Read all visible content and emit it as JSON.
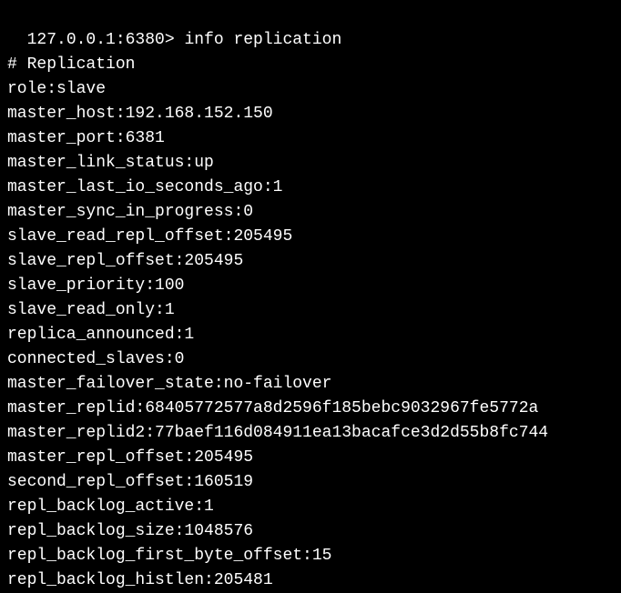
{
  "terminal": {
    "prompt": "127.0.0.1:6380> ",
    "command": "info replication",
    "output": {
      "header": "# Replication",
      "lines": [
        "role:slave",
        "master_host:192.168.152.150",
        "master_port:6381",
        "master_link_status:up",
        "master_last_io_seconds_ago:1",
        "master_sync_in_progress:0",
        "slave_read_repl_offset:205495",
        "slave_repl_offset:205495",
        "slave_priority:100",
        "slave_read_only:1",
        "replica_announced:1",
        "connected_slaves:0",
        "master_failover_state:no-failover",
        "master_replid:68405772577a8d2596f185bebc9032967fe5772a",
        "master_replid2:77baef116d084911ea13bacafce3d2d55b8fc744",
        "master_repl_offset:205495",
        "second_repl_offset:160519",
        "repl_backlog_active:1",
        "repl_backlog_size:1048576",
        "repl_backlog_first_byte_offset:15",
        "repl_backlog_histlen:205481"
      ]
    }
  }
}
